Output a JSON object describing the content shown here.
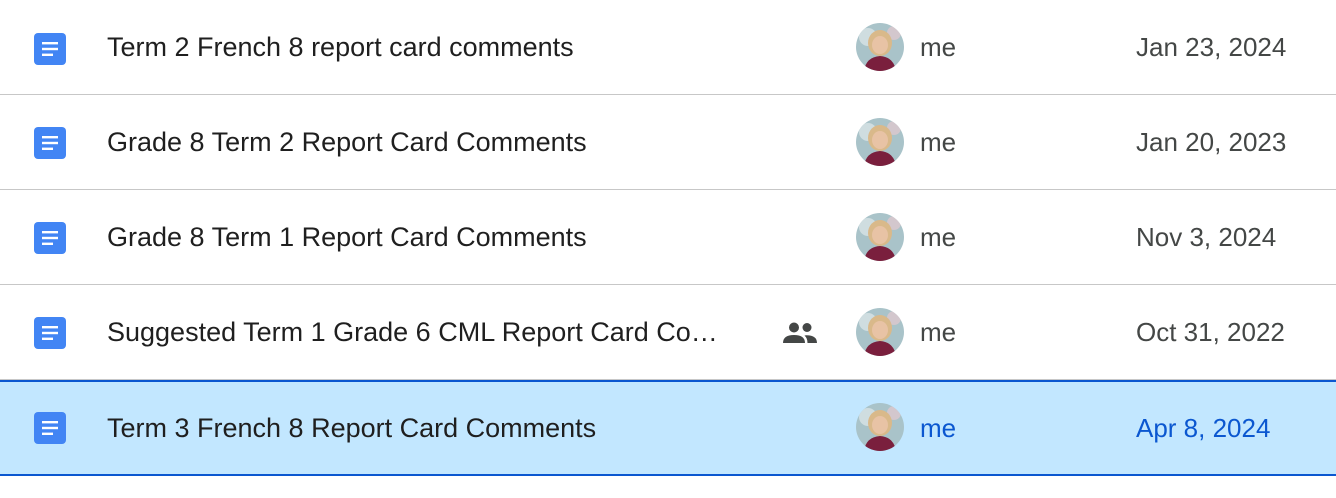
{
  "colors": {
    "doc_icon": "#4285f4",
    "selected_bg": "#c2e7ff",
    "selected_text": "#0b57d0",
    "divider": "#c7c7c7"
  },
  "files": [
    {
      "name": "Term 2 French 8 report card comments",
      "owner": "me",
      "modified": "Jan 23, 2024",
      "shared": false,
      "selected": false,
      "icon": "google-docs-icon"
    },
    {
      "name": "Grade 8 Term 2 Report Card Comments",
      "owner": "me",
      "modified": "Jan 20, 2023",
      "shared": false,
      "selected": false,
      "icon": "google-docs-icon"
    },
    {
      "name": "Grade 8 Term 1 Report Card Comments",
      "owner": "me",
      "modified": "Nov 3, 2024",
      "shared": false,
      "selected": false,
      "icon": "google-docs-icon"
    },
    {
      "name": "Suggested Term 1 Grade 6 CML Report Card Co…",
      "owner": "me",
      "modified": "Oct 31, 2022",
      "shared": true,
      "selected": false,
      "icon": "google-docs-icon"
    },
    {
      "name": "Term 3 French 8 Report Card Comments",
      "owner": "me",
      "modified": "Apr 8, 2024",
      "shared": false,
      "selected": true,
      "icon": "google-docs-icon"
    }
  ]
}
